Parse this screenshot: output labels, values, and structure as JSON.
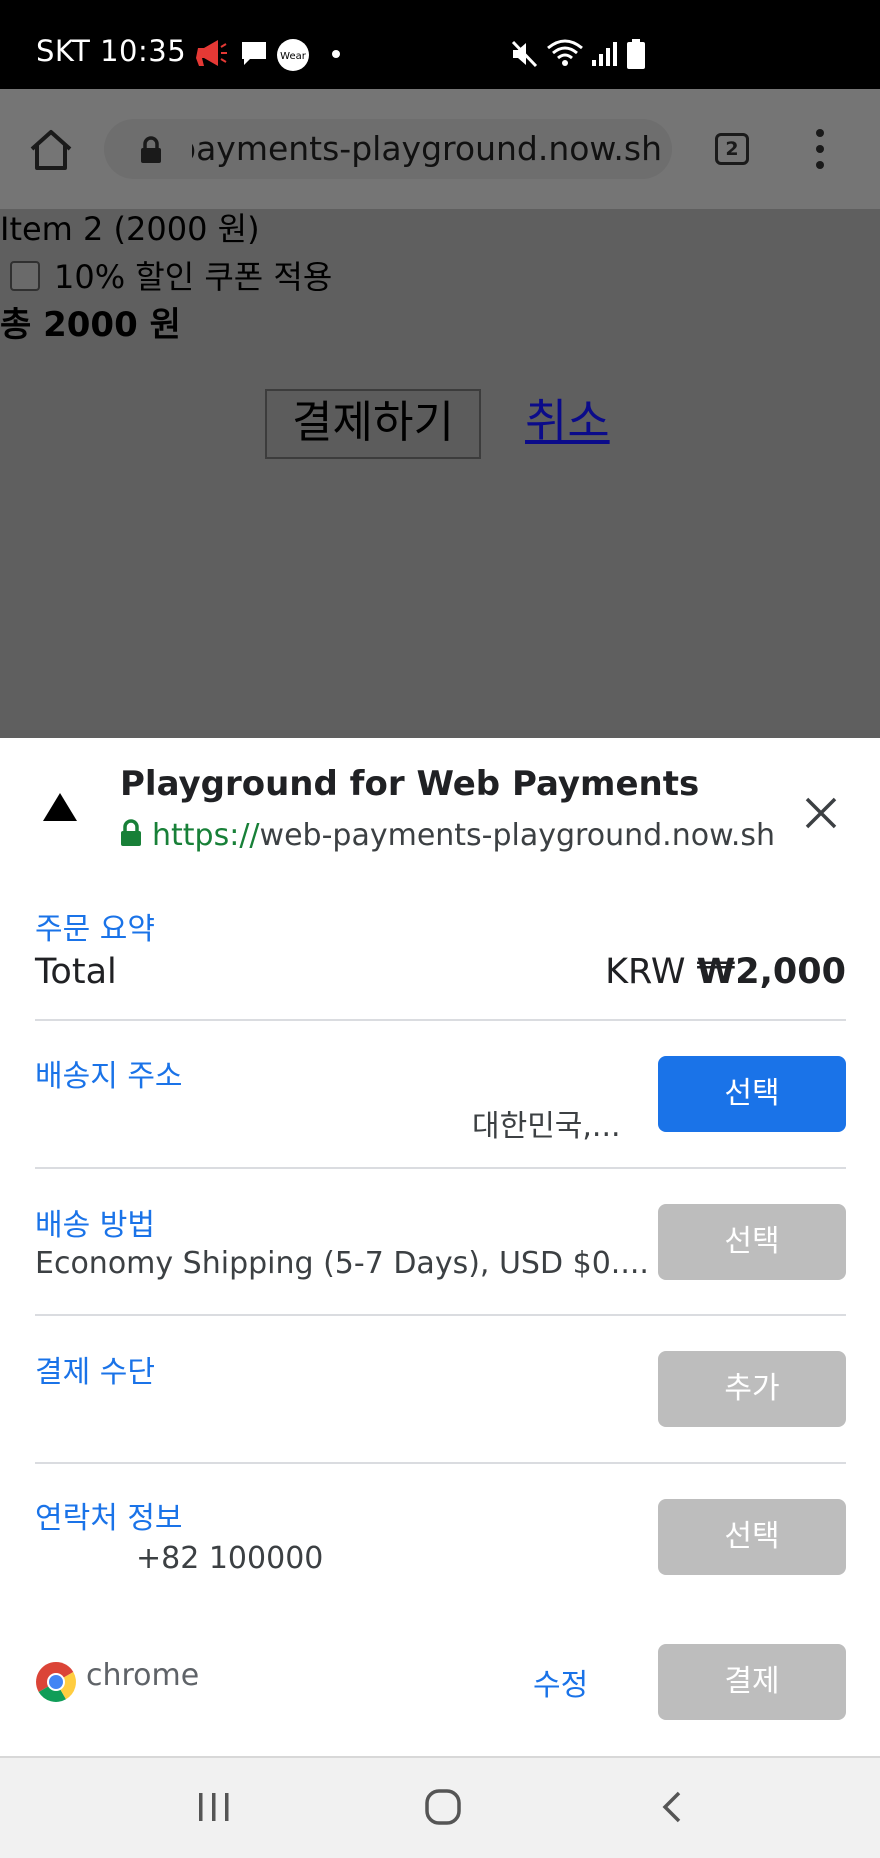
{
  "status_bar": {
    "time": "SKT 10:35",
    "icons": [
      "megaphone-icon",
      "chat-icon",
      "wear-icon",
      "dot-icon",
      "mute-icon",
      "wifi-icon",
      "signal-icon",
      "battery-icon"
    ],
    "wear_label": "Wear"
  },
  "browser": {
    "url": "web-payments-playground.now.sh",
    "tab_count": "2",
    "icons": [
      "home-icon",
      "lock-icon",
      "more-vert-icon"
    ]
  },
  "page": {
    "item": "Item 2 (2000 원)",
    "coupon_label": "10% 할인 쿠폰 적용",
    "coupon_checked": false,
    "total": "총 2000 원",
    "pay_button": "결제하기",
    "cancel_link": "취소"
  },
  "sheet": {
    "title": "Playground for Web Payments",
    "origin_scheme": "https://",
    "origin_host": "web-payments-playground.now.sh",
    "order_summary": {
      "label": "주문 요약",
      "total_label": "Total",
      "currency": "KRW",
      "amount": "₩2,000"
    },
    "shipping_address": {
      "label": "배송지 주소",
      "value": "대한민국,...",
      "button": "선택"
    },
    "shipping_method": {
      "label": "배송 방법",
      "value": "Economy Shipping (5-7 Days), USD $0....",
      "button": "선택"
    },
    "payment_method": {
      "label": "결제 수단",
      "button": "추가"
    },
    "contact_info": {
      "label": "연락처 정보",
      "value": "+82 100000",
      "button": "선택"
    },
    "footer": {
      "brand": "chrome",
      "edit": "수정",
      "pay": "결제"
    },
    "colors": {
      "accent": "#1a73e8",
      "disabled": "#bdbdbd",
      "secure": "#188038"
    }
  },
  "navbar": {
    "icons": [
      "recent-apps-icon",
      "home-circle-icon",
      "back-icon"
    ]
  }
}
